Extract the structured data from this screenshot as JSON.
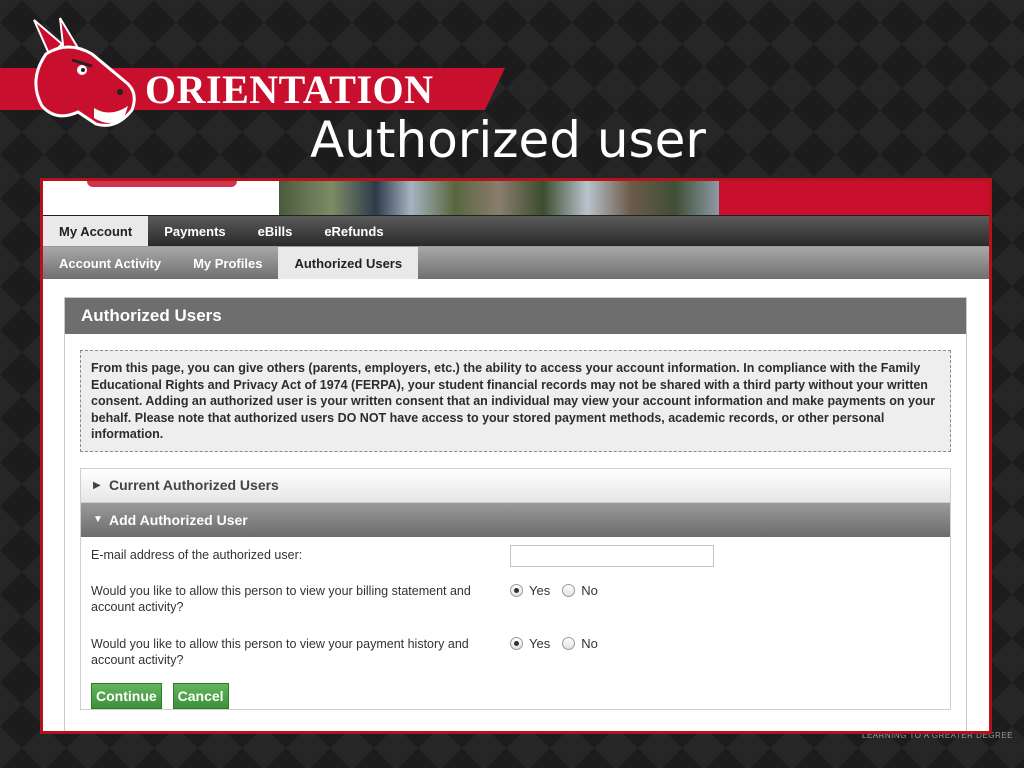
{
  "slide": {
    "banner_title": "ORIENTATION",
    "title": "Authorized user",
    "footer_tagline": "LEARNING TO A GREATER DEGREE"
  },
  "nav": {
    "primary_tabs": [
      "My Account",
      "Payments",
      "eBills",
      "eRefunds"
    ],
    "secondary_tabs": [
      "Account Activity",
      "My Profiles",
      "Authorized Users"
    ]
  },
  "panel": {
    "title": "Authorized Users",
    "notice": "From this page, you can give others (parents, employers, etc.) the ability to access your account information. In compliance with the Family Educational Rights and Privacy Act of 1974 (FERPA), your student financial records may not be shared with a third party without your written consent. Adding an authorized user is your written consent that an individual may view your account information and make payments on your behalf. Please note that authorized users DO NOT have access to your stored payment methods, academic records, or other personal information."
  },
  "accordion": {
    "current_title": "Current Authorized Users",
    "add_title": "Add Authorized User"
  },
  "form": {
    "email_label": "E-mail address of the authorized user:",
    "email_value": "",
    "question_billing": "Would you like to allow this person to view your billing statement and account activity?",
    "question_payment": "Would you like to allow this person to view your payment history and account activity?",
    "option_yes": "Yes",
    "option_no": "No",
    "continue_label": "Continue",
    "cancel_label": "Cancel"
  },
  "colors": {
    "brand_red": "#c8102e",
    "button_green": "#4a9d45",
    "panel_header_gray": "#6e6e6e"
  }
}
